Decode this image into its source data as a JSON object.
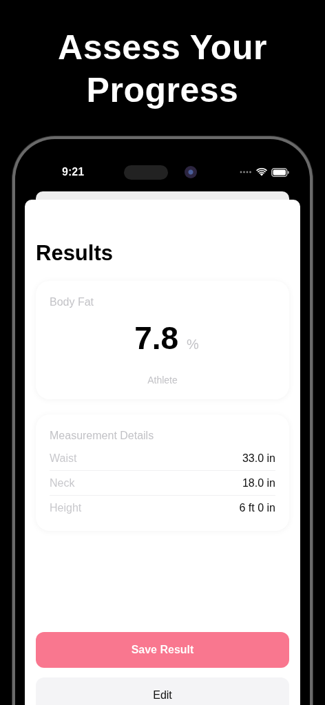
{
  "headline": "Assess Your Progress",
  "status_bar": {
    "time": "9:21"
  },
  "screen": {
    "title": "Results",
    "body_fat": {
      "label": "Body Fat",
      "value": "7.8",
      "unit": "%",
      "category": "Athlete"
    },
    "details": {
      "title": "Measurement Details",
      "rows": [
        {
          "label": "Waist",
          "value": "33.0 in"
        },
        {
          "label": "Neck",
          "value": "18.0 in"
        },
        {
          "label": "Height",
          "value": "6 ft 0 in"
        }
      ]
    },
    "buttons": [
      {
        "label": "Save Result",
        "kind": "primary"
      },
      {
        "label": "Edit",
        "kind": "secondary"
      }
    ]
  }
}
